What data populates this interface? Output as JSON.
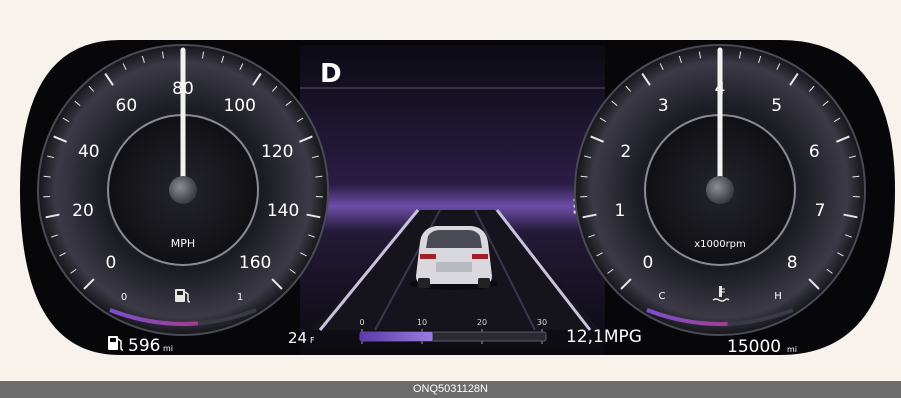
{
  "gear": {
    "value": "D"
  },
  "speedometer": {
    "speed_value": 80,
    "max_value": 160,
    "numbers": [
      "0",
      "20",
      "40",
      "60",
      "80",
      "100",
      "120",
      "140",
      "160"
    ],
    "unit": "MPH",
    "fuel_gauge": {
      "empty_label": "0",
      "full_label": "1",
      "level_fraction": 0.6
    }
  },
  "tachometer": {
    "rpm_value": 4,
    "max_value": 8,
    "numbers": [
      "0",
      "1",
      "2",
      "3",
      "4",
      "5",
      "6",
      "7",
      "8"
    ],
    "unit": "x1000rpm",
    "temp_gauge": {
      "cold_label": "C",
      "hot_label": "H",
      "level_fraction": 0.55
    }
  },
  "status": {
    "range_value": "596",
    "range_unit": "mi",
    "outside_temp_value": "24",
    "outside_temp_unit": "F",
    "fuel_economy": "12,1MPG",
    "odometer_value": "15000",
    "odometer_unit": "mi"
  },
  "mpg_scale": {
    "ticks": [
      "0",
      "10",
      "20",
      "30"
    ],
    "max_value": 30,
    "value": 12.1
  },
  "caption": "ONQ5031128N",
  "colors": {
    "background": "#f7f3ec",
    "cluster": "#070709",
    "needle": "#f2f2f2",
    "accent_purple": "#8b5fd6",
    "accent_red": "#c0305a",
    "caption_bar": "#6c6c6c"
  },
  "icons": [
    "fuel-pump-icon",
    "coolant-temperature-icon",
    "car-rear-icon",
    "menu-dots-icon"
  ]
}
